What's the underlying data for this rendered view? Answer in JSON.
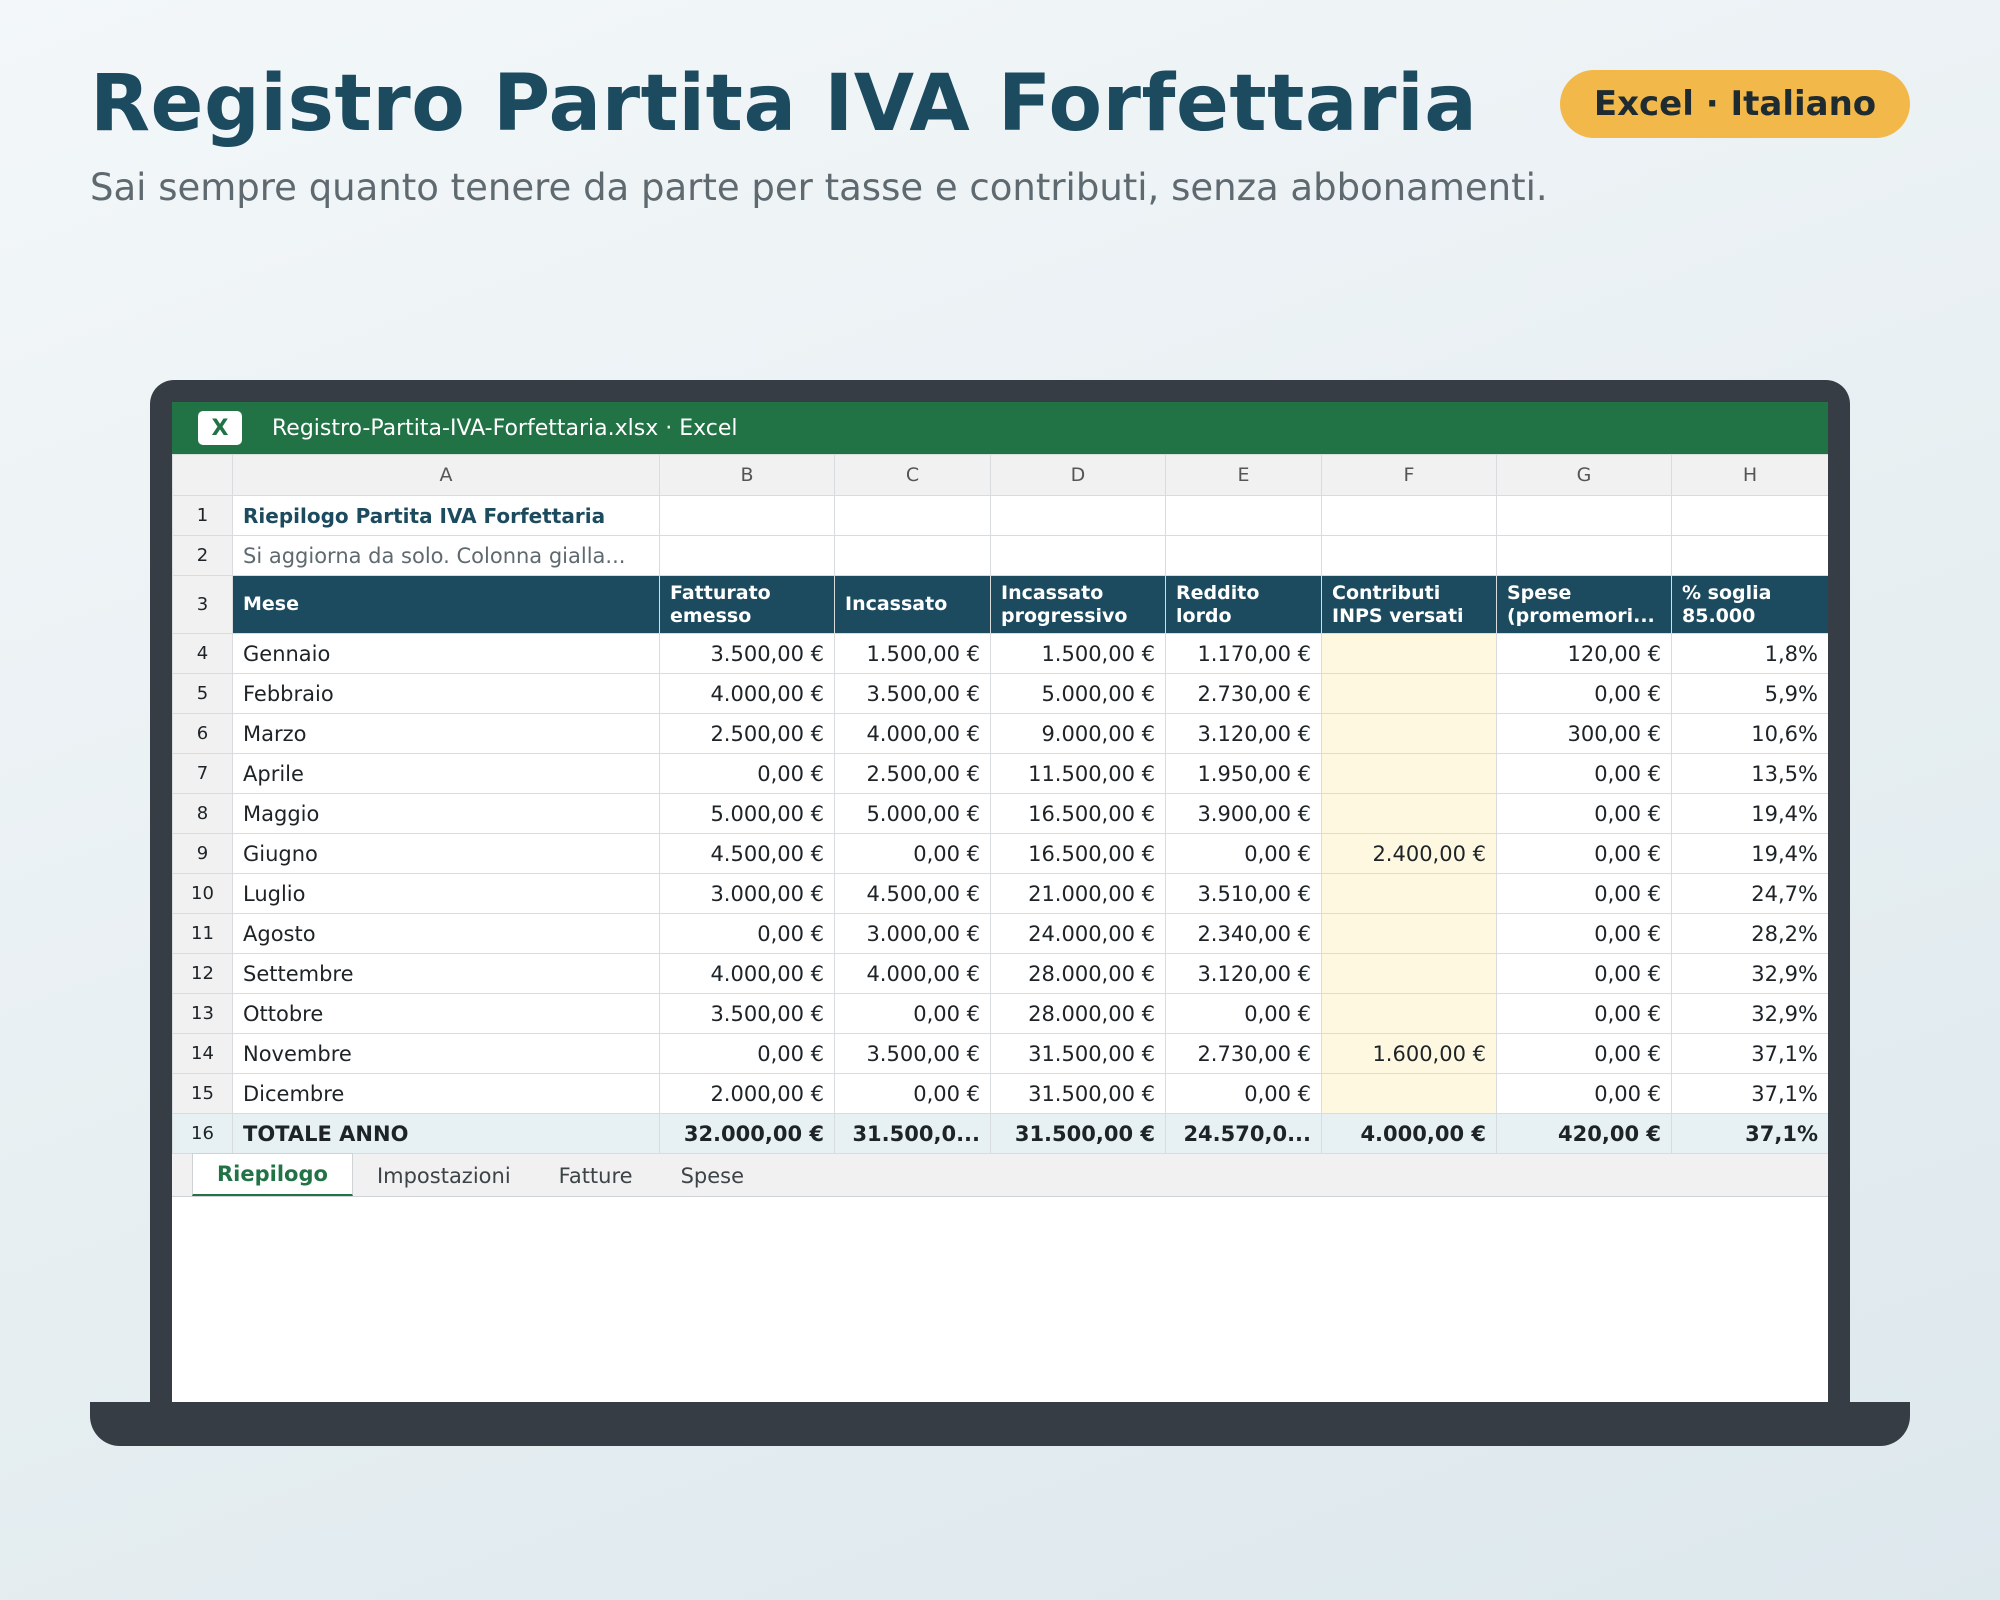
{
  "header": {
    "title": "Registro Partita IVA Forfettaria",
    "subtitle": "Sai sempre quanto tenere da parte per tasse e contributi, senza abbonamenti.",
    "badge": "Excel · Italiano"
  },
  "window": {
    "app_icon_letter": "X",
    "title": "Registro-Partita-IVA-Forfettaria.xlsx · Excel"
  },
  "columns": [
    "A",
    "B",
    "C",
    "D",
    "E",
    "F",
    "G",
    "H"
  ],
  "sheet": {
    "title": "Riepilogo Partita IVA Forfettaria",
    "note": "Si aggiorna da solo. Colonna gialla...",
    "headers": [
      [
        "Mese"
      ],
      [
        "Fatturato",
        "emesso"
      ],
      [
        "Incassato"
      ],
      [
        "Incassato",
        "progressivo"
      ],
      [
        "Reddito",
        "lordo"
      ],
      [
        "Contributi",
        "INPS versati"
      ],
      [
        "Spese",
        "(promemori..."
      ],
      [
        "% soglia",
        "85.000"
      ]
    ],
    "rows": [
      [
        "Gennaio",
        "3.500,00 €",
        "1.500,00 €",
        "1.500,00 €",
        "1.170,00 €",
        "",
        "120,00 €",
        "1,8%"
      ],
      [
        "Febbraio",
        "4.000,00 €",
        "3.500,00 €",
        "5.000,00 €",
        "2.730,00 €",
        "",
        "0,00 €",
        "5,9%"
      ],
      [
        "Marzo",
        "2.500,00 €",
        "4.000,00 €",
        "9.000,00 €",
        "3.120,00 €",
        "",
        "300,00 €",
        "10,6%"
      ],
      [
        "Aprile",
        "0,00 €",
        "2.500,00 €",
        "11.500,00 €",
        "1.950,00 €",
        "",
        "0,00 €",
        "13,5%"
      ],
      [
        "Maggio",
        "5.000,00 €",
        "5.000,00 €",
        "16.500,00 €",
        "3.900,00 €",
        "",
        "0,00 €",
        "19,4%"
      ],
      [
        "Giugno",
        "4.500,00 €",
        "0,00 €",
        "16.500,00 €",
        "0,00 €",
        "2.400,00 €",
        "0,00 €",
        "19,4%"
      ],
      [
        "Luglio",
        "3.000,00 €",
        "4.500,00 €",
        "21.000,00 €",
        "3.510,00 €",
        "",
        "0,00 €",
        "24,7%"
      ],
      [
        "Agosto",
        "0,00 €",
        "3.000,00 €",
        "24.000,00 €",
        "2.340,00 €",
        "",
        "0,00 €",
        "28,2%"
      ],
      [
        "Settembre",
        "4.000,00 €",
        "4.000,00 €",
        "28.000,00 €",
        "3.120,00 €",
        "",
        "0,00 €",
        "32,9%"
      ],
      [
        "Ottobre",
        "3.500,00 €",
        "0,00 €",
        "28.000,00 €",
        "0,00 €",
        "",
        "0,00 €",
        "32,9%"
      ],
      [
        "Novembre",
        "0,00 €",
        "3.500,00 €",
        "31.500,00 €",
        "2.730,00 €",
        "1.600,00 €",
        "0,00 €",
        "37,1%"
      ],
      [
        "Dicembre",
        "2.000,00 €",
        "0,00 €",
        "31.500,00 €",
        "0,00 €",
        "",
        "0,00 €",
        "37,1%"
      ]
    ],
    "total": [
      "TOTALE ANNO",
      "32.000,00 €",
      "31.500,0...",
      "31.500,00 €",
      "24.570,0...",
      "4.000,00 €",
      "420,00 €",
      "37,1%"
    ]
  },
  "tabs": [
    {
      "label": "Riepilogo",
      "active": true
    },
    {
      "label": "Impostazioni",
      "active": false
    },
    {
      "label": "Fatture",
      "active": false
    },
    {
      "label": "Spese",
      "active": false
    }
  ],
  "colors": {
    "title": "#1c4b5f",
    "excel_green": "#217346",
    "badge": "#f3b84a",
    "input_column": "#fef8e1",
    "laptop": "#363d44"
  }
}
